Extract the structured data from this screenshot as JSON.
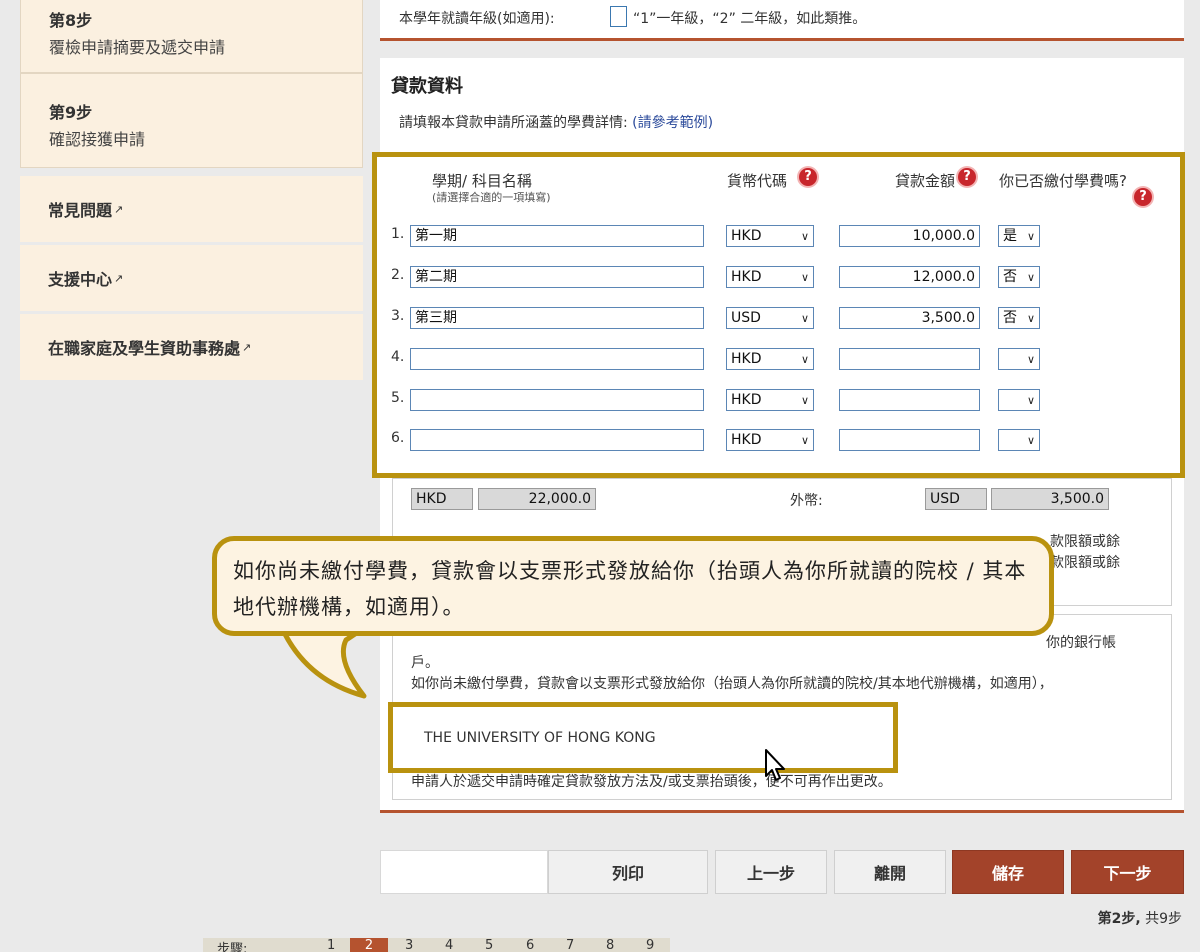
{
  "sidebar": {
    "step8": {
      "num": "第8步",
      "desc": "覆檢申請摘要及遞交申請"
    },
    "step9": {
      "num": "第9步",
      "desc": "確認接獲申請"
    },
    "links": [
      "常見問題",
      "支援中心",
      "在職家庭及學生資助事務處"
    ]
  },
  "grade": {
    "label": "本學年就讀年級(如適用):",
    "hint": "“1”一年級，“2” 二年級，如此類推。"
  },
  "loan": {
    "title": "貸款資料",
    "intro": "請填報本貸款申請所涵蓋的學費詳情:",
    "example_link": "(請參考範例)",
    "headers": {
      "term": "學期/ 科目名稱",
      "term_sub": "(請選擇合適的一項填寫)",
      "currency": "貨幣代碼",
      "amount": "貸款金額",
      "paid": "你已否繳付學費嗎?"
    },
    "rows": [
      {
        "n": "1.",
        "term": "第一期",
        "cur": "HKD",
        "amt": "10,000.0",
        "paid": "是"
      },
      {
        "n": "2.",
        "term": "第二期",
        "cur": "HKD",
        "amt": "12,000.0",
        "paid": "否"
      },
      {
        "n": "3.",
        "term": "第三期",
        "cur": "USD",
        "amt": "3,500.0",
        "paid": "否"
      },
      {
        "n": "4.",
        "term": "",
        "cur": "HKD",
        "amt": "",
        "paid": ""
      },
      {
        "n": "5.",
        "term": "",
        "cur": "HKD",
        "amt": "",
        "paid": ""
      },
      {
        "n": "6.",
        "term": "",
        "cur": "HKD",
        "amt": "",
        "paid": ""
      }
    ],
    "totals": {
      "hkd_code": "HKD",
      "hkd_total": "22,000.0",
      "foreign_label": "外幣:",
      "fx_code": "USD",
      "fx_total": "3,500.0"
    },
    "note_right_1": "款限額或餘",
    "note_right_2": "款限額或餘"
  },
  "callout_text": "如你尚未繳付學費，貸款會以支票形式發放給你（抬頭人為你所就讀的院校 / 其本地代辦機構，如適用）。",
  "payment": {
    "line_partial_right": "你的銀行帳",
    "line_hu": "戶。",
    "line_cheque": "如你尚未繳付學費，貸款會以支票形式發放給你（抬頭人為你所就讀的院校/其本地代辦機構，如適用），",
    "payee_name": "THE UNIVERSITY OF HONG KONG",
    "final_note": "申請人於遞交申請時確定貸款發放方法及/或支票抬頭後，便不可再作出更改。"
  },
  "buttons": {
    "print": "列印",
    "prev": "上一步",
    "leave": "離開",
    "save": "儲存",
    "next": "下一步"
  },
  "step_status": {
    "current": "第2步,",
    "total": " 共9步"
  },
  "pager": {
    "label": "步驟:",
    "pages": [
      "1",
      "2",
      "3",
      "4",
      "5",
      "6",
      "7",
      "8",
      "9"
    ]
  }
}
